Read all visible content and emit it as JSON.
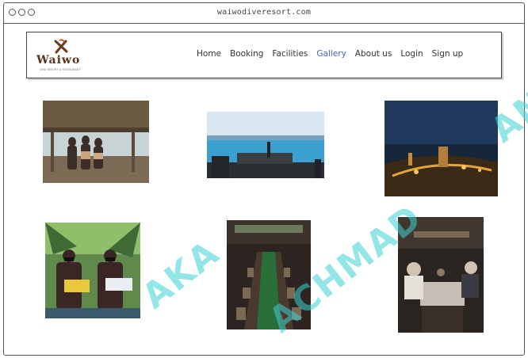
{
  "browser": {
    "url": "waiwodiveresort.com"
  },
  "header": {
    "logo_text": "Waiwo",
    "logo_sub": "DIVE RESORT & RESTAURANT"
  },
  "nav": {
    "items": [
      {
        "label": "Home"
      },
      {
        "label": "Booking"
      },
      {
        "label": "Facilities"
      },
      {
        "label": "Gallery",
        "active": true
      },
      {
        "label": "About us"
      },
      {
        "label": "Login"
      },
      {
        "label": "Sign up"
      }
    ]
  },
  "gallery": {
    "photos": [
      {
        "subject": "group on wooden jetty"
      },
      {
        "subject": "sea view dining setup"
      },
      {
        "subject": "night seaside lights"
      },
      {
        "subject": "staff with welcome drinks"
      },
      {
        "subject": "restaurant long table"
      },
      {
        "subject": "dinner group inside hall"
      }
    ]
  },
  "watermark": {
    "line1": "AKA",
    "line2": "ACHMAD",
    "line3": "AN"
  },
  "colors": {
    "accent": "#4a63c9",
    "logo": "#5a3320",
    "watermark": "#3cd2d2"
  }
}
